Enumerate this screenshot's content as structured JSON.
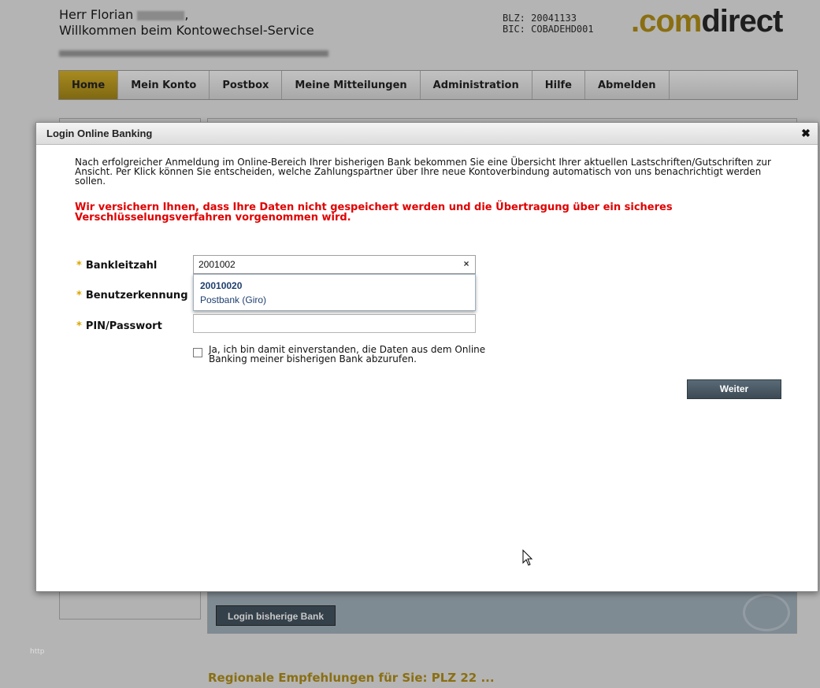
{
  "header": {
    "greeting_line1": "Herr Florian",
    "greeting_line1_suffix": ",",
    "greeting_line2": "Willkommen beim Kontowechsel-Service",
    "blz": "BLZ: 20041133",
    "bic": "BIC: COBADEHD001",
    "logo_dot": ".",
    "logo_com": "com",
    "logo_direct": "direct"
  },
  "nav": {
    "items": [
      "Home",
      "Mein Konto",
      "Postbox",
      "Meine Mitteilungen",
      "Administration",
      "Hilfe",
      "Abmelden"
    ],
    "active": "Home"
  },
  "background": {
    "login_button": "Login bisherige Bank",
    "http_label": "http",
    "regional_heading": "Regionale Empfehlungen für Sie: PLZ 22 ..."
  },
  "modal": {
    "title": "Login Online Banking",
    "close_icon": "close-icon",
    "intro": "Nach erfolgreicher Anmeldung im Online-Bereich Ihrer bisherigen Bank bekommen Sie eine Übersicht Ihrer aktuellen Lastschriften/Gutschriften zur Ansicht. Per Klick können Sie entscheiden, welche Zahlungspartner über Ihre neue Kontoverbindung automatisch von uns benachrichtigt werden sollen.",
    "warning": "Wir versichern Ihnen, dass Ihre Daten nicht gespeichert werden und die Übertragung über ein sicheres Verschlüsselungsverfahren vorgenommen wird.",
    "required_marker": "*",
    "fields": {
      "blz_label": "Bankleitzahl",
      "blz_value": "2001002",
      "user_label": "Benutzerkennung",
      "pin_label": "PIN/Passwort",
      "pin_value": ""
    },
    "suggestion": {
      "code": "20010020",
      "name": "Postbank (Giro)"
    },
    "consent_text": "Ja, ich bin damit einverstanden, die Daten aus dem Online Banking meiner bisherigen Bank abzurufen.",
    "consent_checked": false,
    "submit_label": "Weiter"
  },
  "colors": {
    "warning": "#e00000",
    "accent": "#d9a500",
    "button": "#3c4a55",
    "link": "#1f3f6e"
  }
}
